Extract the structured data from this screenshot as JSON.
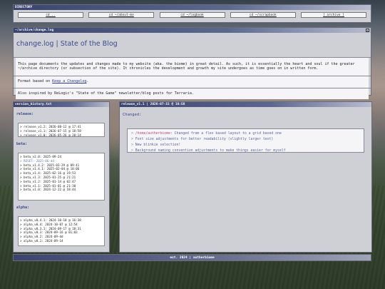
{
  "directory": {
    "title": "DIRECTORY",
    "links": [
      "cd ..",
      "cd ~/about-me",
      "cd ~/logbook",
      "cd ~/scrapbook",
      "[ archive ]"
    ]
  },
  "changelog": {
    "titlebar": "~/archive/change.log",
    "close": "x",
    "heading": "change.log | State of the Blog",
    "para1": "This page documents the updates and changes made to my website (aka. the biome) in great detail. As such, it is essentially the heart and soul if the greater ~/archive directory (or subsection of the site). It chronicles the development and growth my site undergoes as time goes on in written form.",
    "para2_prefix": "Format based on ",
    "para2_link": "Keep a Changelog",
    "para2_suffix": ".",
    "para3": "Also inspired by ReLogic's \"State of the Game\" newsletter/blog posts for Terraria."
  },
  "history": {
    "titlebar": "version_history.txt",
    "release_label": "release:",
    "release_items": [
      "> release_v1.2: 2026-08-12 @ 17:41",
      "> release_v1.1: 2026-07-15 @ 18:58",
      "> release_v1.0: 2026-05-26 @ 20:14"
    ],
    "beta_label": "beta:",
    "beta_items": [
      "> beta_v2.0: 2025-09-24",
      "> RESET: 2025-06-dd",
      "> beta_v1.4.2: 2025-03-29 @ 09:41",
      "> beta_v1.4.1: 2025-02-04 @ 10:06",
      "> beta_v1.4: 2025-02-16 @ 19:53",
      "> beta_v1.3: 2025-01-25 @ 21:21",
      "> beta_v1.2: 2025-01-14 @ 02:47",
      "> beta_v1.1: 2025-01-01 @ 21:30",
      "> beta_v1.0: 2024-12-22 @ 18:44"
    ],
    "alpha_label": "alpha:",
    "alpha_items": [
      "> alpha_v0.4.1: 2024-10-10 @ 16:38",
      "> alpha_v0.4: 2024-10-07 @ 12:54",
      "> alpha_v0.3.1: 2024-09-17 @ 18:31",
      "> alpha_v0.3: 2024-09-16 @ 01:03",
      "> alpha_v0.2: 2024-09-dd",
      "> alpha_v0.1: 2024-09-14"
    ]
  },
  "release": {
    "titlebar": "release_v1.1 | 2026-07-15 @ 18:58",
    "changed_label": "Changed:",
    "changes": [
      {
        "path": "/home/autherbiome",
        "text": ": Changed from a flex based layout to a grid based one"
      },
      {
        "path": "",
        "text": "Font size adjustments for better readability (slightly larger text)"
      },
      {
        "path": "",
        "text": "New blinkie selection!"
      },
      {
        "path": "",
        "text": "Background naming convention adjustments to make things easier for myself"
      }
    ]
  },
  "footer": {
    "text": "est. 2024 | autherbiome"
  }
}
